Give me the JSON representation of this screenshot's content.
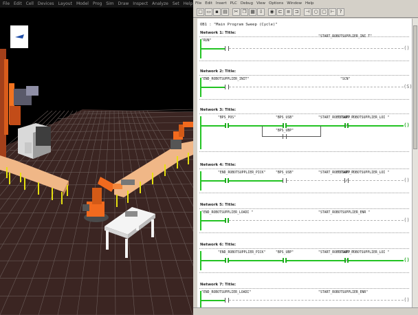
{
  "sim": {
    "menu": [
      "File",
      "Edit",
      "Cell",
      "Devices",
      "Layout",
      "Model",
      "Prog",
      "Sim",
      "Draw",
      "Inspect",
      "Analyze",
      "Set",
      "Help"
    ],
    "colors": {
      "floor": "#3b2522",
      "grid": "#6b5d5a",
      "conveyor": "#f0b787",
      "legs": "#e6e010",
      "robot": "#f26a1e",
      "table": "#f4f4f4"
    }
  },
  "editor": {
    "menu": [
      "File",
      "Edit",
      "Insert",
      "PLC",
      "Debug",
      "View",
      "Options",
      "Window",
      "Help"
    ],
    "toolbar_icons": [
      "new-icon",
      "open-icon",
      "save-icon",
      "print-icon",
      "cut-icon",
      "copy-icon",
      "paste-icon",
      "download-icon",
      "monitor-icon",
      "ladder-icon",
      "stl-icon",
      "fbd-icon",
      "contact-icon",
      "coil-icon",
      "box-icon",
      "branch-icon",
      "help-icon"
    ],
    "block_title": "OB1 :  \"Main Program Sweep (Cycle)\"",
    "networks": [
      {
        "header": "Network 1: Title:",
        "contacts": [
          {
            "label": "\"RUN\"",
            "state": "off",
            "type": "NO"
          }
        ],
        "coil": {
          "label": "\"START_ROBOTSUPPLIER_INI T\"",
          "state": "off"
        }
      },
      {
        "header": "Network 2: Title:",
        "contacts": [
          {
            "label": "\"END_ROBOTSUPPLIER_INIT\"",
            "state": "off",
            "type": "NO"
          }
        ],
        "coil": {
          "label": "\"SCN\"",
          "state": "off",
          "coil_type": "S"
        }
      },
      {
        "header": "Network 3: Title:",
        "contacts": [
          {
            "label": "\"BPS_POS\"",
            "state": "on",
            "type": "NO"
          },
          {
            "label": "\"BPS_USB\"",
            "state": "on",
            "type": "NO"
          },
          {
            "label": "\"START_ROBOTSUPPLIER_LOI \"",
            "state": "on",
            "type": "NC"
          }
        ],
        "branch_contact": {
          "label": "\"BPS_UBP\"",
          "state": "off",
          "type": "NO"
        },
        "coil": {
          "label": "\"START_ROBOTSUPP \"",
          "state": "on"
        }
      },
      {
        "header": "Network 4: Title:",
        "contacts": [
          {
            "label": "\"END_ROBOTSUPPLIER_PICK\"",
            "state": "on",
            "type": "NO"
          },
          {
            "label": "\"BPS_USB\"",
            "state": "off",
            "type": "NO"
          },
          {
            "label": "\"START_ROBOTSUPPLIER_LOI \"",
            "state": "off",
            "type": "NC"
          }
        ],
        "coil": {
          "label": "\"START_ROBOTSUPP \"",
          "state": "off"
        }
      },
      {
        "header": "Network 5: Title:",
        "contacts": [
          {
            "label": "\"END_ROBOTSUPPLIER_LOADI \"",
            "state": "on",
            "type": "NO"
          }
        ],
        "coil": {
          "label": "\"START_ROBOTSUPPLIER_ENR \"",
          "state": "off"
        }
      },
      {
        "header": "Network 6: Title:",
        "contacts": [
          {
            "label": "\"END_ROBOTSUPPLIER_PICK\"",
            "state": "on",
            "type": "NO"
          },
          {
            "label": "\"BPS_UBP\"",
            "state": "on",
            "type": "NO"
          },
          {
            "label": "\"START_ROBOTSUPPLIER_LOI \"",
            "state": "on",
            "type": "NC"
          }
        ],
        "coil": {
          "label": "\"START_ROBOTSUPP \"",
          "state": "on"
        }
      },
      {
        "header": "Network 7: Title:",
        "contacts": [
          {
            "label": "\"END_ROBOTSUPPLIER_LOADI\"",
            "state": "off",
            "type": "NO"
          }
        ],
        "coil": {
          "label": "\"START_ROBOTSUPPLIER_ENR\"",
          "state": "off"
        }
      }
    ]
  }
}
